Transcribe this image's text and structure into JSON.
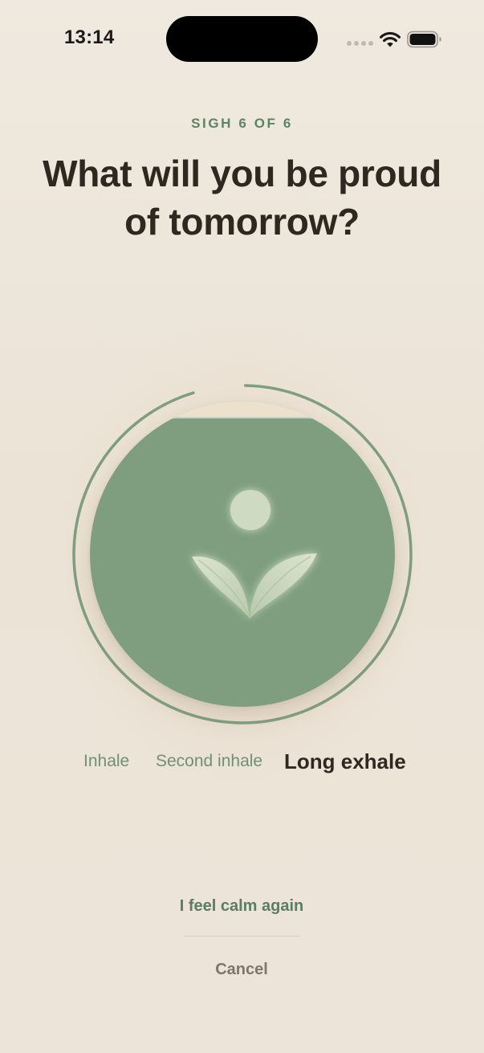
{
  "status_bar": {
    "time": "13:14",
    "icons": [
      "cellular-signal-icon",
      "wifi-icon",
      "battery-icon"
    ]
  },
  "header": {
    "step_label": "SIGH 6 OF 6",
    "prompt": "What will you be proud of tomorrow?"
  },
  "breathing": {
    "fill_fraction": 0.95,
    "ring_progress": 0.95,
    "icon": "sprout-sun-icon",
    "phases": [
      "Inhale",
      "Second inhale",
      "Long exhale"
    ],
    "active_phase": "Long exhale"
  },
  "actions": {
    "calm_label": "I feel calm again",
    "cancel_label": "Cancel"
  },
  "colors": {
    "background": "#ede6db",
    "accent": "#7f9e80",
    "accent_text": "#5b8463",
    "title": "#2f2821",
    "muted": "#7c766f"
  }
}
